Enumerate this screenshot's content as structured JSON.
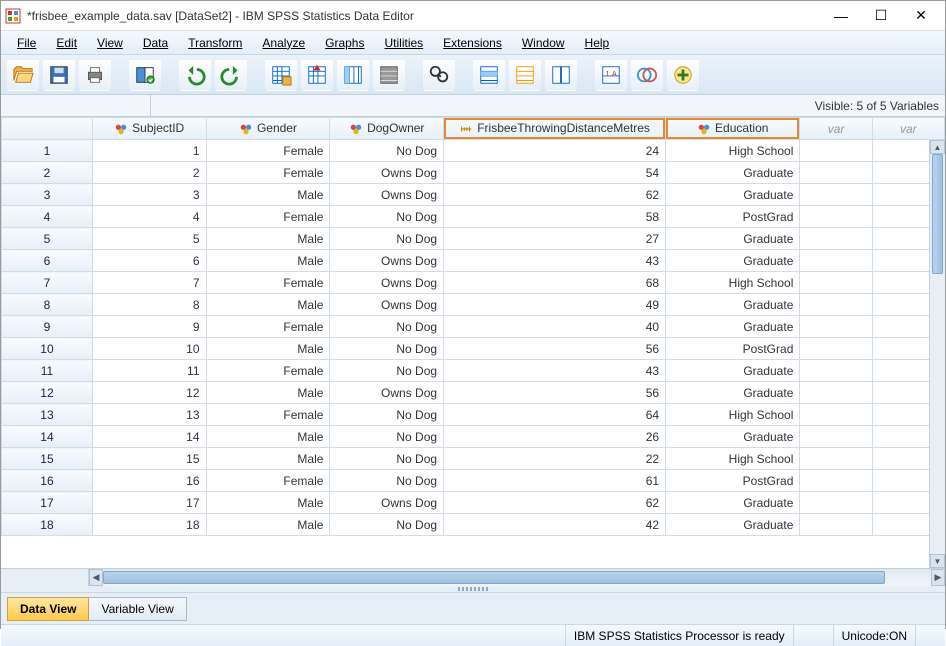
{
  "window": {
    "title": "*frisbee_example_data.sav [DataSet2] - IBM SPSS Statistics Data Editor"
  },
  "menu": [
    "File",
    "Edit",
    "View",
    "Data",
    "Transform",
    "Analyze",
    "Graphs",
    "Utilities",
    "Extensions",
    "Window",
    "Help"
  ],
  "info": {
    "visible_vars": "Visible: 5 of 5 Variables"
  },
  "columns": [
    {
      "name": "SubjectID",
      "type": "nominal",
      "highlight": false
    },
    {
      "name": "Gender",
      "type": "nominal",
      "highlight": false
    },
    {
      "name": "DogOwner",
      "type": "nominal",
      "highlight": false
    },
    {
      "name": "FrisbeeThrowingDistanceMetres",
      "type": "scale",
      "highlight": true
    },
    {
      "name": "Education",
      "type": "nominal",
      "highlight": true
    }
  ],
  "empty_col_label": "var",
  "rows": [
    {
      "n": 1,
      "SubjectID": "1",
      "Gender": "Female",
      "DogOwner": "No Dog",
      "Frisbee": "24",
      "Education": "High School"
    },
    {
      "n": 2,
      "SubjectID": "2",
      "Gender": "Female",
      "DogOwner": "Owns Dog",
      "Frisbee": "54",
      "Education": "Graduate"
    },
    {
      "n": 3,
      "SubjectID": "3",
      "Gender": "Male",
      "DogOwner": "Owns Dog",
      "Frisbee": "62",
      "Education": "Graduate"
    },
    {
      "n": 4,
      "SubjectID": "4",
      "Gender": "Female",
      "DogOwner": "No Dog",
      "Frisbee": "58",
      "Education": "PostGrad"
    },
    {
      "n": 5,
      "SubjectID": "5",
      "Gender": "Male",
      "DogOwner": "No Dog",
      "Frisbee": "27",
      "Education": "Graduate"
    },
    {
      "n": 6,
      "SubjectID": "6",
      "Gender": "Male",
      "DogOwner": "Owns Dog",
      "Frisbee": "43",
      "Education": "Graduate"
    },
    {
      "n": 7,
      "SubjectID": "7",
      "Gender": "Female",
      "DogOwner": "Owns Dog",
      "Frisbee": "68",
      "Education": "High School"
    },
    {
      "n": 8,
      "SubjectID": "8",
      "Gender": "Male",
      "DogOwner": "Owns Dog",
      "Frisbee": "49",
      "Education": "Graduate"
    },
    {
      "n": 9,
      "SubjectID": "9",
      "Gender": "Female",
      "DogOwner": "No Dog",
      "Frisbee": "40",
      "Education": "Graduate"
    },
    {
      "n": 10,
      "SubjectID": "10",
      "Gender": "Male",
      "DogOwner": "No Dog",
      "Frisbee": "56",
      "Education": "PostGrad"
    },
    {
      "n": 11,
      "SubjectID": "11",
      "Gender": "Female",
      "DogOwner": "No Dog",
      "Frisbee": "43",
      "Education": "Graduate"
    },
    {
      "n": 12,
      "SubjectID": "12",
      "Gender": "Male",
      "DogOwner": "Owns Dog",
      "Frisbee": "56",
      "Education": "Graduate"
    },
    {
      "n": 13,
      "SubjectID": "13",
      "Gender": "Female",
      "DogOwner": "No Dog",
      "Frisbee": "64",
      "Education": "High School"
    },
    {
      "n": 14,
      "SubjectID": "14",
      "Gender": "Male",
      "DogOwner": "No Dog",
      "Frisbee": "26",
      "Education": "Graduate"
    },
    {
      "n": 15,
      "SubjectID": "15",
      "Gender": "Male",
      "DogOwner": "No Dog",
      "Frisbee": "22",
      "Education": "High School"
    },
    {
      "n": 16,
      "SubjectID": "16",
      "Gender": "Female",
      "DogOwner": "No Dog",
      "Frisbee": "61",
      "Education": "PostGrad"
    },
    {
      "n": 17,
      "SubjectID": "17",
      "Gender": "Male",
      "DogOwner": "Owns Dog",
      "Frisbee": "62",
      "Education": "Graduate"
    },
    {
      "n": 18,
      "SubjectID": "18",
      "Gender": "Male",
      "DogOwner": "No Dog",
      "Frisbee": "42",
      "Education": "Graduate"
    }
  ],
  "tabs": {
    "data_view": "Data View",
    "variable_view": "Variable View"
  },
  "status": {
    "processor": "IBM SPSS Statistics Processor is ready",
    "unicode": "Unicode:ON"
  }
}
